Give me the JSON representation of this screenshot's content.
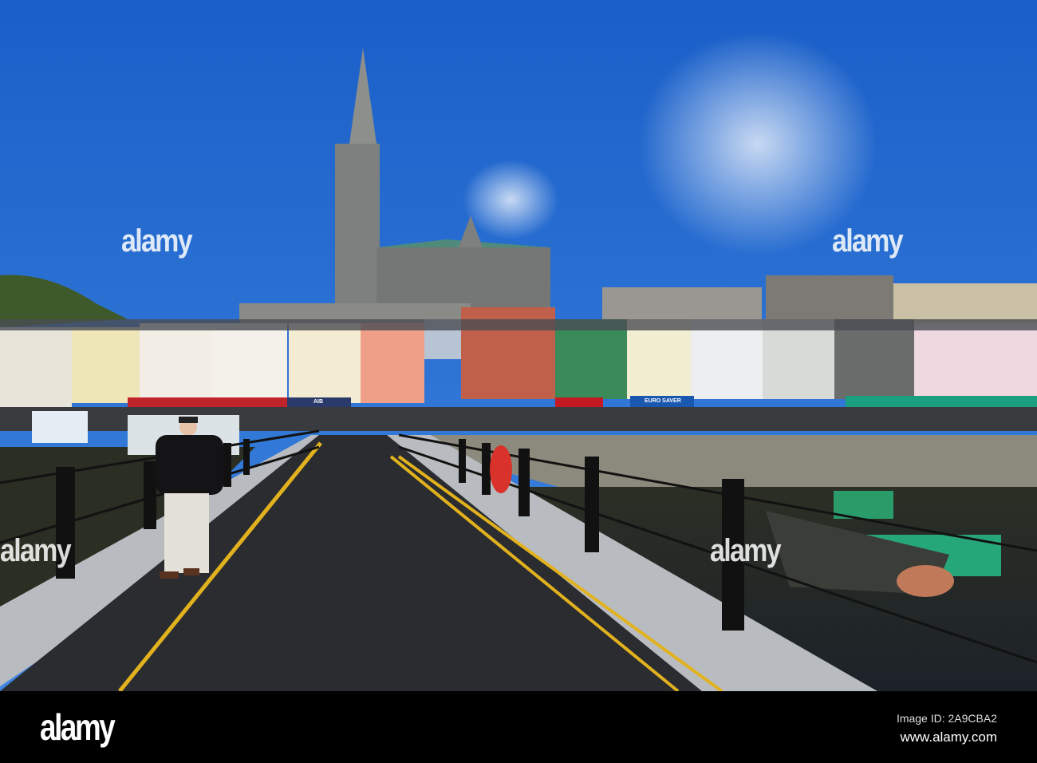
{
  "photo": {
    "shop_signs": [
      "AIB",
      "EURO SAVER"
    ]
  },
  "watermark": {
    "text": "alamy"
  },
  "footer": {
    "logo": "alamy",
    "image_id": "Image ID: 2A9CBA2",
    "website": "www.alamy.com"
  }
}
